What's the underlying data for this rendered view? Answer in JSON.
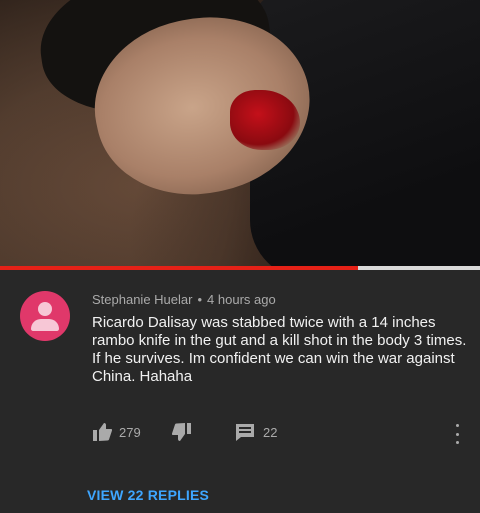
{
  "video": {
    "progress_fraction": 0.745,
    "progress_color": "#e62117"
  },
  "comment": {
    "author": "Stephanie Huelar",
    "separator": "•",
    "timestamp": "4 hours ago",
    "text_line1": "Ricardo Dalisay was stabbed twice with a 14 inches rambo knife in the gut and a kill shot in the body 3 times.",
    "text_line2": "If he survives. Im confident we can win the war against China. Hahaha",
    "like_count": "279",
    "reply_count": "22",
    "view_replies_label": "VIEW 22 REPLIES",
    "avatar_color": "#e0386a"
  },
  "icons": {
    "like": "thumbs-up-icon",
    "dislike": "thumbs-down-icon",
    "reply": "comment-icon",
    "more": "more-vertical-icon"
  }
}
